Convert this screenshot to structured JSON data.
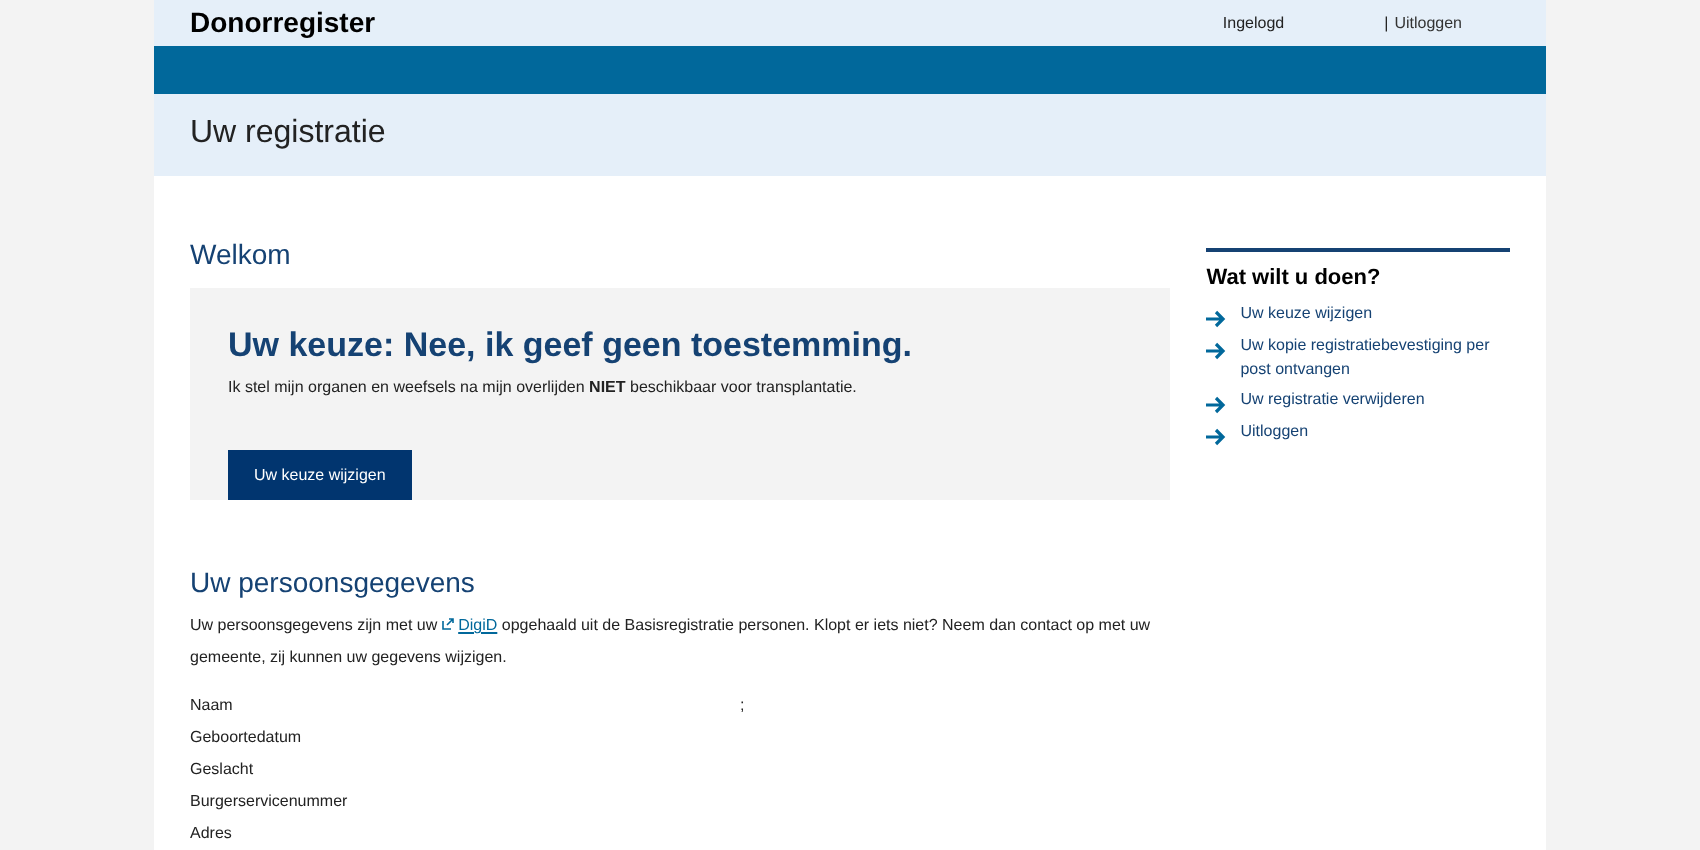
{
  "header": {
    "brand": "Donorregister",
    "status": "Ingelogd",
    "separator": "|",
    "logout": "Uitloggen"
  },
  "page_title": "Uw registratie",
  "welcome": {
    "heading": "Welkom",
    "choice_title": "Uw keuze: Nee, ik geef geen toestemming.",
    "choice_text": "Ik stel mijn organen en weefsels na mijn overlijden **NIET** beschikbaar voor transplantatie.",
    "button": "Uw keuze wijzigen"
  },
  "personal": {
    "heading": "Uw persoonsgegevens",
    "intro_before": "Uw persoonsgegevens zijn met uw",
    "link": "DigiD",
    "intro_after": "opgehaald uit de Basisregistratie personen. Klopt er iets niet? Neem dan contact op met uw gemeente, zij kunnen uw gegevens wijzigen.",
    "fields": [
      {
        "label": "Naam",
        "value": ";"
      },
      {
        "label": "Geboortedatum"
      },
      {
        "label": "Geslacht"
      },
      {
        "label": "Burgerservicenummer"
      },
      {
        "label": "Adres"
      }
    ]
  },
  "sidebar": {
    "heading": "Wat wilt u doen?",
    "items": [
      "Uw keuze wijzigen",
      "Uw kopie registratiebevestiging per post ontvangen",
      "Uw registratie verwijderen",
      "Uitloggen"
    ]
  }
}
